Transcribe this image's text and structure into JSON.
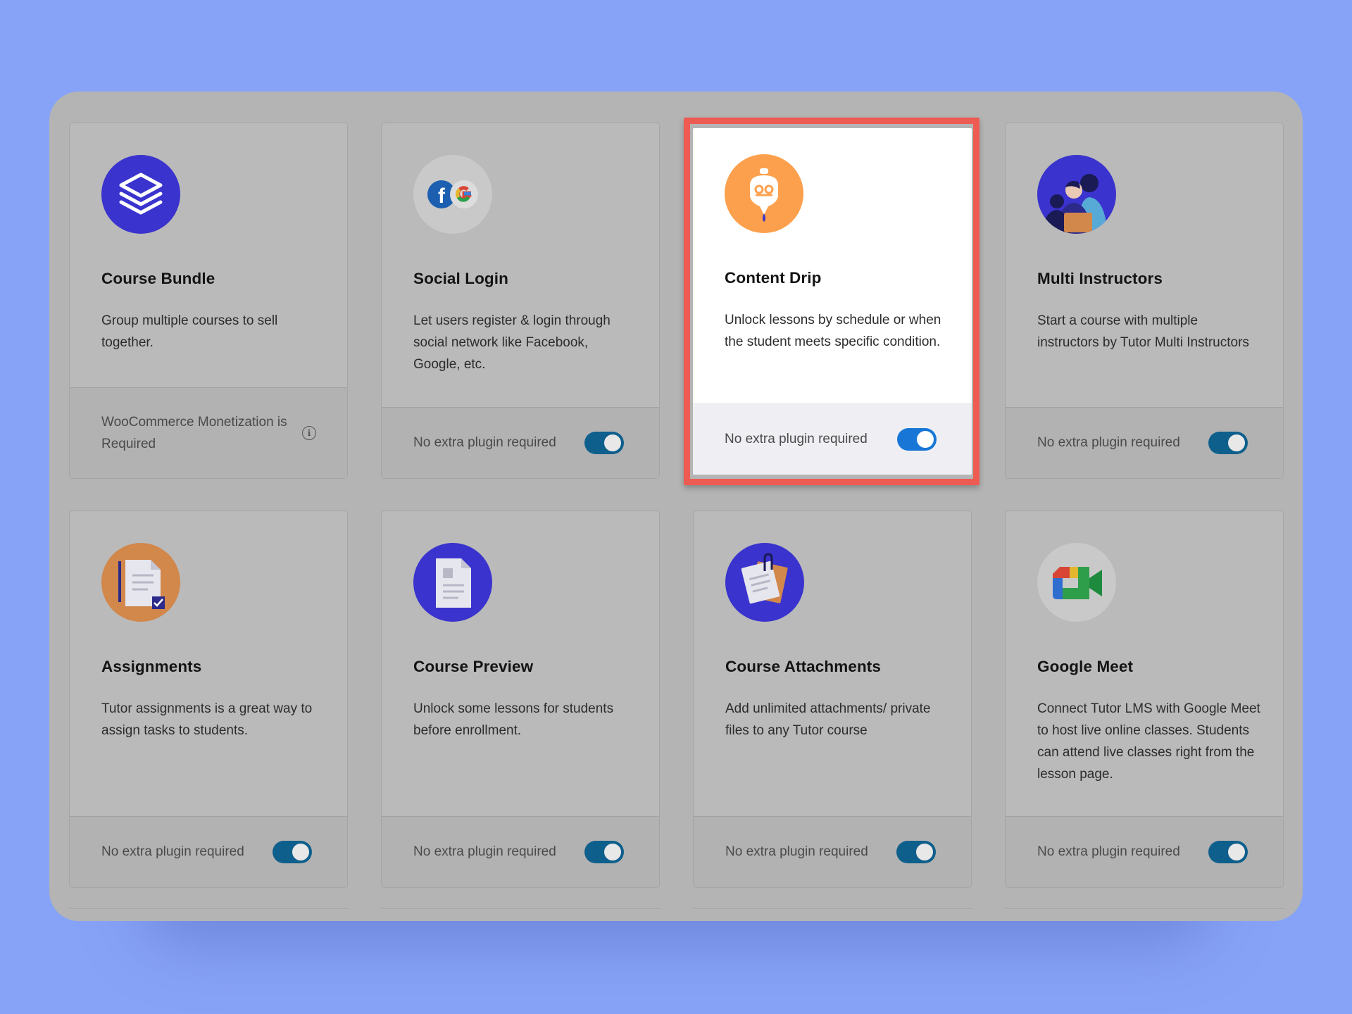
{
  "addons": [
    {
      "title": "Course Bundle",
      "description": "Group multiple courses to sell together.",
      "footer_text": "WooCommerce Monetization is Required",
      "footer_type": "info",
      "icon": "layers-stack-icon",
      "icon_bg": "#3A33CE"
    },
    {
      "title": "Social Login",
      "description": "Let users register & login through social network like Facebook, Google, etc.",
      "footer_text": "No extra plugin required",
      "footer_type": "toggle",
      "toggle_on": true,
      "icon": "facebook-google-icon",
      "icon_bg": "#C9C9C9"
    },
    {
      "title": "Content Drip",
      "description": "Unlock lessons by schedule or when the student meets specific condition.",
      "footer_text": "No extra plugin required",
      "footer_type": "toggle",
      "toggle_on": true,
      "highlighted": true,
      "icon": "drip-icon",
      "icon_bg": "#FCA04D"
    },
    {
      "title": "Multi Instructors",
      "description": "Start a course with multiple instructors by Tutor Multi Instructors",
      "footer_text": "No extra plugin required",
      "footer_type": "toggle",
      "toggle_on": true,
      "icon": "people-group-icon",
      "icon_bg": "#3A33CE"
    },
    {
      "title": "Assignments",
      "description": "Tutor assignments is a great way to assign tasks to students.",
      "footer_text": "No extra plugin required",
      "footer_type": "toggle",
      "toggle_on": true,
      "icon": "assignment-document-icon",
      "icon_bg": "#D2874B"
    },
    {
      "title": "Course Preview",
      "description": "Unlock some lessons for students before enrollment.",
      "footer_text": "No extra plugin required",
      "footer_type": "toggle",
      "toggle_on": true,
      "icon": "document-preview-icon",
      "icon_bg": "#3A33CE"
    },
    {
      "title": "Course Attachments",
      "description": "Add unlimited attachments/ private files to any Tutor course",
      "footer_text": "No extra plugin required",
      "footer_type": "toggle",
      "toggle_on": true,
      "icon": "paperclip-notes-icon",
      "icon_bg": "#3A33CE"
    },
    {
      "title": "Google Meet",
      "description": "Connect Tutor LMS with Google Meet to host live online classes. Students can attend live classes right from the lesson page.",
      "footer_text": "No extra plugin required",
      "footer_type": "toggle",
      "toggle_on": true,
      "icon": "google-meet-icon",
      "icon_bg": "#C9C9C9"
    }
  ],
  "colors": {
    "page_background": "#87A3F7",
    "highlight_border": "#EE5B52",
    "toggle_on": "#1877D6"
  }
}
